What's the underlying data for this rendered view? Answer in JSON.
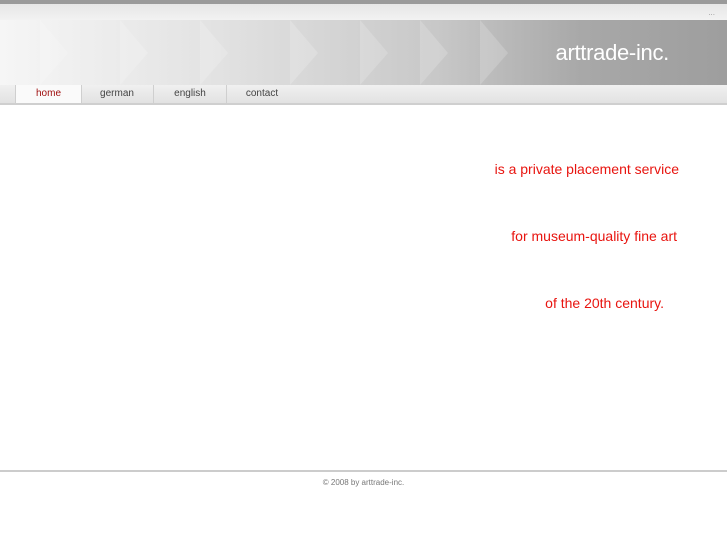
{
  "header": {
    "logo": "arttrade-inc.",
    "corner": "..."
  },
  "nav": [
    {
      "label": "home",
      "active": true
    },
    {
      "label": "german"
    },
    {
      "label": "english"
    },
    {
      "label": "contact"
    }
  ],
  "main": {
    "lines": [
      "is a private placement service",
      "for museum-quality fine art",
      "of the 20th century."
    ]
  },
  "footer": {
    "copyright": "© 2008 by arttrade-inc."
  },
  "colors": {
    "accent": "#e8140f",
    "active_tab": "#a01010"
  }
}
